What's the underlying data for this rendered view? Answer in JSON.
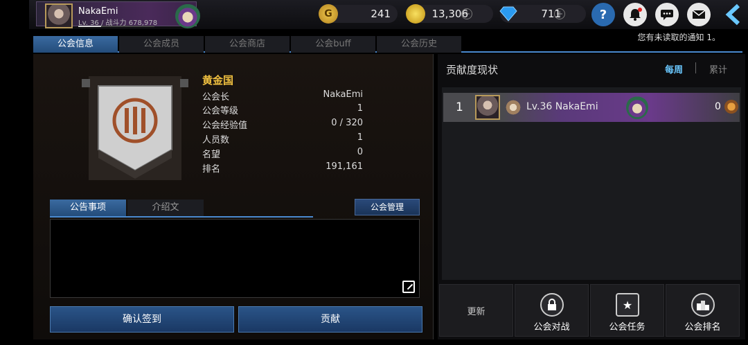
{
  "player": {
    "name": "NakaEmi",
    "level_power": "Lv. 36 / 战斗力 678,978"
  },
  "currencies": [
    {
      "icon": "G",
      "value": "241"
    },
    {
      "icon": "",
      "value": "13,306"
    },
    {
      "icon": "",
      "value": "711"
    }
  ],
  "notification_text": "您有未读取的通知 1。",
  "tabs": [
    "公会信息",
    "公会成员",
    "公会商店",
    "公会buff",
    "公会历史"
  ],
  "guild": {
    "name": "黄金国",
    "rows": [
      {
        "label": "公会长",
        "value": "NakaEmi"
      },
      {
        "label": "公会等级",
        "value": "1"
      },
      {
        "label": "公会经验值",
        "value": "0 / 320"
      },
      {
        "label": "人员数",
        "value": "1"
      },
      {
        "label": "名望",
        "value": "0"
      },
      {
        "label": "排名",
        "value": "191,161"
      }
    ]
  },
  "sub_tabs": [
    "公告事项",
    "介绍文"
  ],
  "manage_label": "公会管理",
  "checkin_label": "确认签到",
  "contribute_label": "贡献",
  "contribution": {
    "title": "贡献度现状",
    "weekly": "每周",
    "cumulative": "累计",
    "entries": [
      {
        "rank": "1",
        "name": "Lv.36 NakaEmi",
        "score": "0"
      }
    ]
  },
  "bottom": {
    "refresh": "更新",
    "guild_battle": "公会对战",
    "guild_quest": "公会任务",
    "guild_ranking": "公会排名"
  },
  "colors": {
    "accent_blue": "#3a6aa0",
    "guild_name": "#f0c040",
    "banner_emblem": "#a0502a"
  }
}
